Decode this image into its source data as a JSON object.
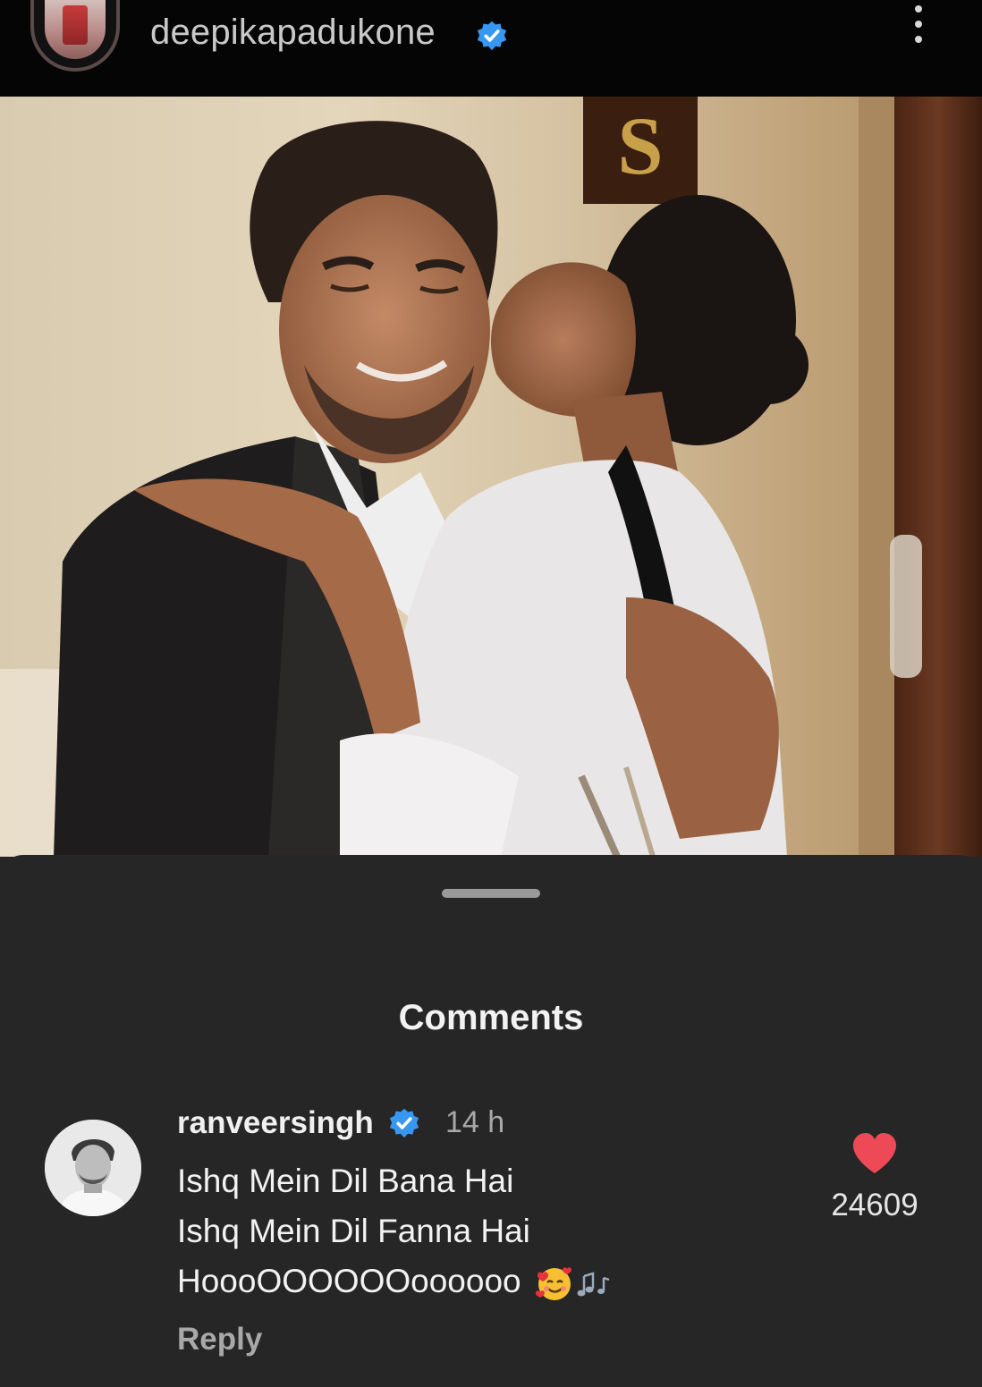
{
  "header": {
    "username": "deepikapadukone",
    "more_icon": "more-vertical-icon"
  },
  "photo": {
    "sign_letter": "S"
  },
  "comments_sheet": {
    "title": "Comments",
    "comment": {
      "username": "ranveersingh",
      "time": "14 h",
      "lines": [
        "Ishq Mein Dil Bana Hai",
        "Ishq Mein Dil Fanna Hai",
        "HoooOOOOOOoooooo"
      ],
      "emoji": [
        "smiling-face-with-hearts-icon",
        "musical-notes-icon"
      ],
      "reply_label": "Reply",
      "likes": "24609"
    }
  },
  "colors": {
    "header_bg": "#050505",
    "sheet_bg": "#262626",
    "verified_blue": "#3897f0",
    "heart_red": "#ed4956"
  }
}
